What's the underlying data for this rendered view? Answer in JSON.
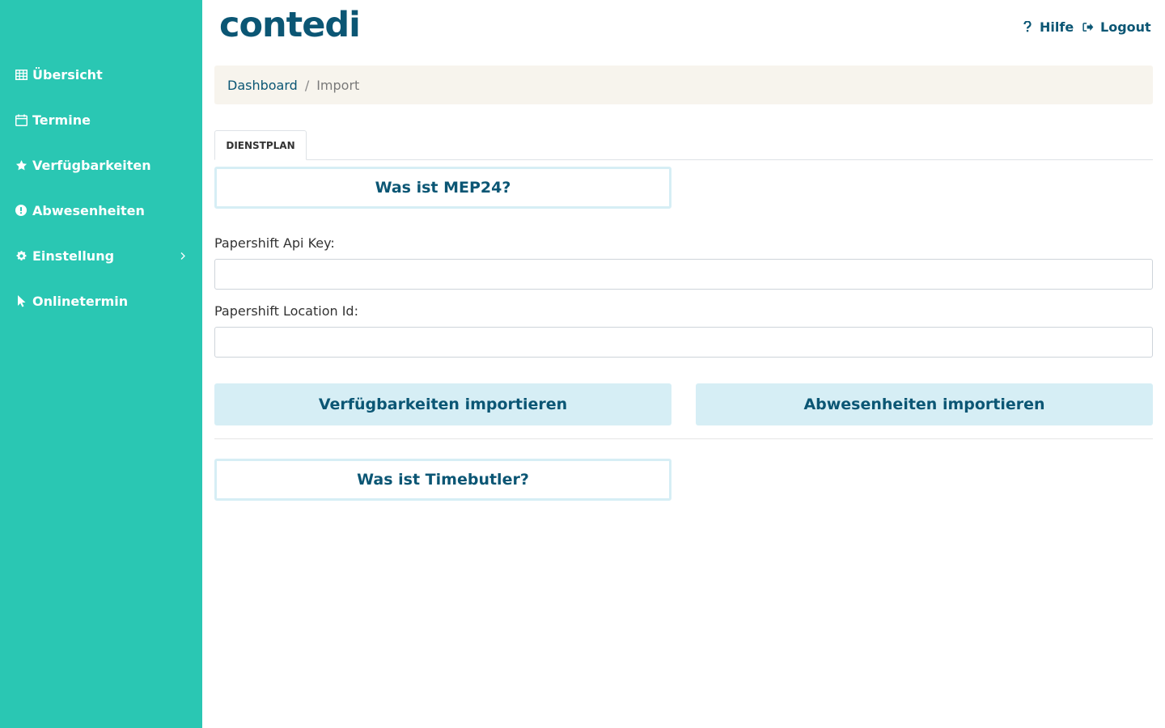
{
  "app": {
    "logo": "contedi",
    "help_label": "Hilfe",
    "logout_label": "Logout"
  },
  "sidebar": {
    "items": [
      {
        "label": "Übersicht",
        "icon": "table-icon"
      },
      {
        "label": "Termine",
        "icon": "calendar-icon"
      },
      {
        "label": "Verfügbarkeiten",
        "icon": "star-icon"
      },
      {
        "label": "Abwesenheiten",
        "icon": "exclamation-circle-icon"
      },
      {
        "label": "Einstellung",
        "icon": "gear-icon",
        "has_submenu": true
      },
      {
        "label": "Onlinetermin",
        "icon": "cursor-icon"
      }
    ]
  },
  "breadcrumb": {
    "root": "Dashboard",
    "separator": "/",
    "current": "Import"
  },
  "tabs": [
    {
      "label": "DIENSTPLAN",
      "active": true
    }
  ],
  "main": {
    "mep24_button": "Was ist MEP24?",
    "api_key_label": "Papershift Api Key:",
    "api_key_value": "",
    "location_id_label": "Papershift Location Id:",
    "location_id_value": "",
    "import_availability_button": "Verfügbarkeiten importieren",
    "import_absences_button": "Abwesenheiten importieren",
    "timebutler_button": "Was ist Timebutler?"
  },
  "colors": {
    "sidebar": "#2ac7b3",
    "brand": "#0b5674",
    "breadcrumb_bg": "#f7f4ed",
    "button_light": "#d6eef5"
  }
}
